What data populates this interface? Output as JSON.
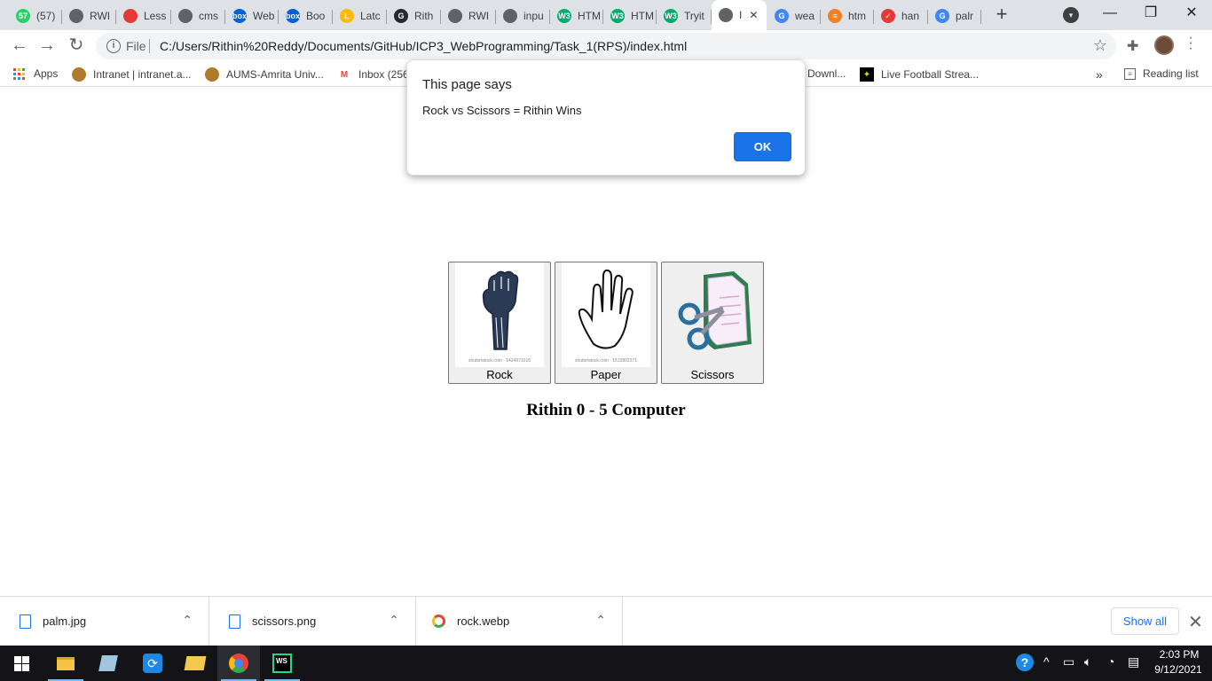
{
  "browser": {
    "tabs": [
      {
        "label": "(57)",
        "icon": "whatsapp-icon",
        "color": "#25d366",
        "glyph": "57"
      },
      {
        "label": "RWI",
        "icon": "globe-icon",
        "color": "#5f6368",
        "glyph": ""
      },
      {
        "label": "Less",
        "icon": "lifebuoy-icon",
        "color": "#e53935",
        "glyph": ""
      },
      {
        "label": "cms",
        "icon": "globe-icon",
        "color": "#5f6368",
        "glyph": ""
      },
      {
        "label": "Web",
        "icon": "box-icon",
        "color": "#0061d5",
        "glyph": "box"
      },
      {
        "label": "Boo",
        "icon": "box-icon",
        "color": "#0061d5",
        "glyph": "box"
      },
      {
        "label": "Latc",
        "icon": "latch-icon",
        "color": "#fbbc05",
        "glyph": "L"
      },
      {
        "label": "Rith",
        "icon": "github-icon",
        "color": "#24292e",
        "glyph": "G"
      },
      {
        "label": "RWI",
        "icon": "globe-icon",
        "color": "#5f6368",
        "glyph": ""
      },
      {
        "label": "inpu",
        "icon": "globe-icon",
        "color": "#5f6368",
        "glyph": ""
      },
      {
        "label": "HTM",
        "icon": "w3schools-icon",
        "color": "#04aa6d",
        "glyph": "W3"
      },
      {
        "label": "HTM",
        "icon": "w3schools-icon",
        "color": "#04aa6d",
        "glyph": "W3"
      },
      {
        "label": "Tryit",
        "icon": "w3schools-icon",
        "color": "#04aa6d",
        "glyph": "W3"
      },
      {
        "label": "I",
        "icon": "globe-icon",
        "color": "#5f6368",
        "glyph": "",
        "active": true
      },
      {
        "label": "wea",
        "icon": "google-icon",
        "color": "#4285f4",
        "glyph": "G"
      },
      {
        "label": "htm",
        "icon": "stackoverflow-icon",
        "color": "#f48024",
        "glyph": "≡"
      },
      {
        "label": "han",
        "icon": "red-app-icon",
        "color": "#e53935",
        "glyph": "✓"
      },
      {
        "label": "palr",
        "icon": "google-icon",
        "color": "#4285f4",
        "glyph": "G"
      }
    ],
    "url_scheme": "File",
    "url": "C:/Users/Rithin%20Reddy/Documents/GitHub/ICP3_WebProgramming/Task_1(RPS)/index.html",
    "bookmarks": [
      {
        "label": "Apps",
        "icon": "apps-grid-icon"
      },
      {
        "label": "Intranet | intranet.a...",
        "icon": "amrita-logo-icon"
      },
      {
        "label": "AUMS-Amrita Univ...",
        "icon": "amrita-logo-icon"
      },
      {
        "label": "Inbox (256",
        "icon": "gmail-icon"
      },
      {
        "label": "Downl...",
        "icon": "bookmark-icon"
      },
      {
        "label": "Live Football Strea...",
        "icon": "football-icon"
      }
    ],
    "more_bookmarks": "»",
    "reading_list": "Reading list"
  },
  "page": {
    "choices": [
      {
        "label": "Rock",
        "image_credit": "shutterstock.com · 1424971016"
      },
      {
        "label": "Paper",
        "image_credit": "shutterstock.com · 1513802371"
      },
      {
        "label": "Scissors"
      }
    ],
    "score_text": "Rithin 0 - 5 Computer"
  },
  "alert": {
    "title": "This page says",
    "message": "Rock vs Scissors = Rithin Wins",
    "ok_label": "OK"
  },
  "downloads": {
    "items": [
      {
        "name": "palm.jpg",
        "icon": "image-file-icon"
      },
      {
        "name": "scissors.png",
        "icon": "image-file-icon"
      },
      {
        "name": "rock.webp",
        "icon": "chrome-icon"
      }
    ],
    "show_all_label": "Show all"
  },
  "taskbar": {
    "time": "2:03 PM",
    "date": "9/12/2021",
    "apps": [
      "start-icon",
      "file-explorer-icon",
      "notepad-icon",
      "sync-icon",
      "folder-icon",
      "chrome-icon",
      "webstorm-icon"
    ]
  },
  "colors": {
    "accent": "#1a73e8",
    "tabstrip": "#dee1e6",
    "taskbar": "#141418"
  }
}
